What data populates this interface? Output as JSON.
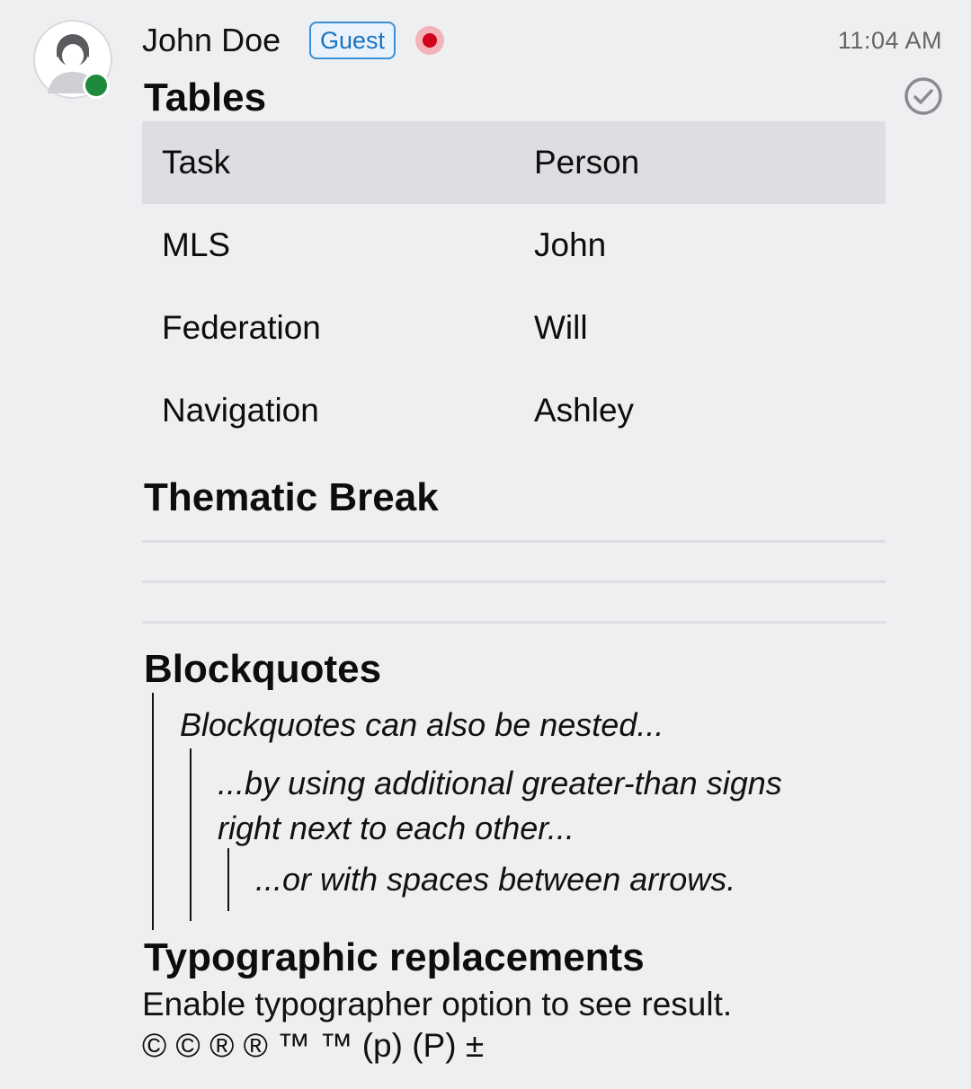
{
  "message": {
    "author": "John Doe",
    "badge": "Guest",
    "time": "11:04 AM",
    "icons": {
      "avatar": "user-avatar-icon",
      "presence": "online-dot",
      "status": "recording-dot-icon",
      "read_receipt": "check-circle-icon"
    },
    "colors": {
      "presence_online": "#1f8a3b",
      "status_dot": "#d0021b",
      "guest_badge": "#1b74c2"
    }
  },
  "sections": {
    "tables": {
      "heading": "Tables",
      "columns": [
        "Task",
        "Person"
      ],
      "rows": [
        [
          "MLS",
          "John"
        ],
        [
          "Federation",
          "Will"
        ],
        [
          "Navigation",
          "Ashley"
        ]
      ]
    },
    "thematic": {
      "heading": "Thematic Break"
    },
    "blockquotes": {
      "heading": "Blockquotes",
      "level1": "Blockquotes can also be nested...",
      "level2": "...by using additional greater-than signs right next to each other...",
      "level3": "...or with spaces between arrows."
    },
    "typographic": {
      "heading": "Typographic replacements",
      "line1": "Enable typographer option to see result.",
      "line2": "© © ® ® ™ ™ (p) (P) ±"
    }
  }
}
